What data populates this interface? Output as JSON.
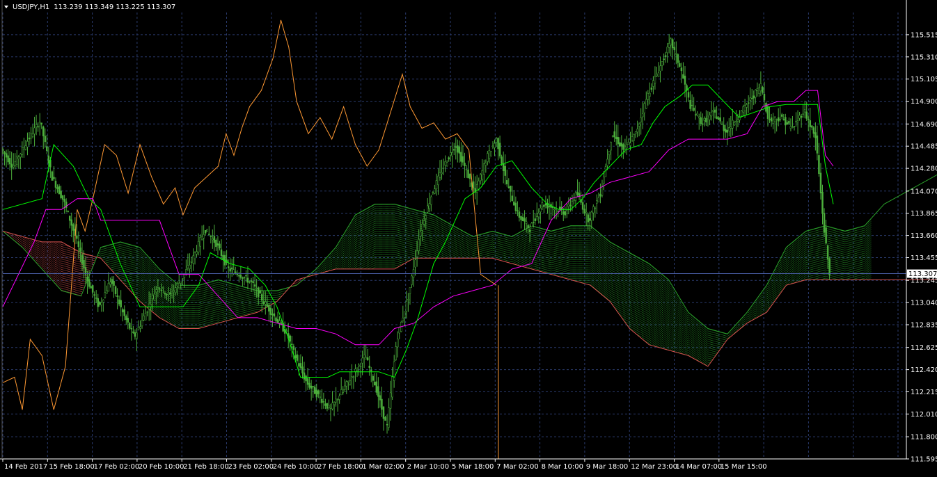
{
  "header": {
    "symbol": "USDJPY,H1",
    "quote": "113.239 113.349 113.225 113.307"
  },
  "chart_data": {
    "type": "line",
    "subtype": "candlestick-ichimoku",
    "symbol": "USDJPY",
    "timeframe": "H1",
    "ohlc_last": {
      "open": 113.239,
      "high": 113.349,
      "low": 113.225,
      "close": 113.307
    },
    "current_price_label": "113.307",
    "current_price": 113.307,
    "grid": true,
    "legend": "none",
    "ylim": [
      111.595,
      115.72
    ],
    "y_ticks": [
      "115.515",
      "115.310",
      "115.105",
      "114.900",
      "114.690",
      "114.485",
      "114.280",
      "114.070",
      "113.865",
      "113.660",
      "113.455",
      "113.245",
      "113.040",
      "112.835",
      "112.625",
      "112.420",
      "112.215",
      "112.010",
      "111.800",
      "111.595"
    ],
    "x_ticks": [
      "14 Feb 2017",
      "15 Feb 18:00",
      "17 Feb 02:00",
      "20 Feb 10:00",
      "21 Feb 18:00",
      "23 Feb 02:00",
      "24 Feb 10:00",
      "27 Feb 18:00",
      "1 Mar 02:00",
      "2 Mar 10:00",
      "5 Mar 18:00",
      "7 Mar 02:00",
      "8 Mar 10:00",
      "9 Mar 18:00",
      "12 Mar 23:00",
      "14 Mar 07:00",
      "15 Mar 15:00"
    ],
    "x_extent": [
      0,
      22
    ],
    "colors": {
      "background": "#000000",
      "grid": "#2b3b6e",
      "axis": "#ffffff",
      "text": "#ffffff",
      "candles": "#4cae3c",
      "tenkan": "#00ff00",
      "kijun": "#ff00ff",
      "chikou": "#ff9933",
      "kumo_bull": "#2aa12a",
      "kumo_bear": "#d9534f",
      "price_line": "#4a5fa8"
    },
    "series_points": {
      "price_path": [
        [
          0,
          114.46
        ],
        [
          0.3,
          114.3
        ],
        [
          0.7,
          114.55
        ],
        [
          1.0,
          114.72
        ],
        [
          1.3,
          114.2
        ],
        [
          1.6,
          113.98
        ],
        [
          1.9,
          113.65
        ],
        [
          2.2,
          113.25
        ],
        [
          2.5,
          113.0
        ],
        [
          2.8,
          113.25
        ],
        [
          3.1,
          112.95
        ],
        [
          3.4,
          112.72
        ],
        [
          3.7,
          112.95
        ],
        [
          4.0,
          113.2
        ],
        [
          4.3,
          113.1
        ],
        [
          4.6,
          113.25
        ],
        [
          4.9,
          113.45
        ],
        [
          5.2,
          113.72
        ],
        [
          5.5,
          113.58
        ],
        [
          5.8,
          113.35
        ],
        [
          6.1,
          113.3
        ],
        [
          6.4,
          113.22
        ],
        [
          6.7,
          113.05
        ],
        [
          7.0,
          112.9
        ],
        [
          7.3,
          112.75
        ],
        [
          7.5,
          112.55
        ],
        [
          7.8,
          112.3
        ],
        [
          8.1,
          112.18
        ],
        [
          8.4,
          112.05
        ],
        [
          8.7,
          112.22
        ],
        [
          9.0,
          112.38
        ],
        [
          9.3,
          112.55
        ],
        [
          9.6,
          112.22
        ],
        [
          9.85,
          111.88
        ],
        [
          10.1,
          112.7
        ],
        [
          10.4,
          113.1
        ],
        [
          10.7,
          113.7
        ],
        [
          11.0,
          114.05
        ],
        [
          11.3,
          114.3
        ],
        [
          11.6,
          114.5
        ],
        [
          11.85,
          114.28
        ],
        [
          12.1,
          114.05
        ],
        [
          12.4,
          114.38
        ],
        [
          12.65,
          114.55
        ],
        [
          12.9,
          114.15
        ],
        [
          13.2,
          113.85
        ],
        [
          13.5,
          113.72
        ],
        [
          13.8,
          113.95
        ],
        [
          14.1,
          113.92
        ],
        [
          14.4,
          113.87
        ],
        [
          14.7,
          114.05
        ],
        [
          15.0,
          113.8
        ],
        [
          15.3,
          114.05
        ],
        [
          15.6,
          114.6
        ],
        [
          15.9,
          114.45
        ],
        [
          16.2,
          114.6
        ],
        [
          16.5,
          114.95
        ],
        [
          16.8,
          115.2
        ],
        [
          17.1,
          115.45
        ],
        [
          17.35,
          115.2
        ],
        [
          17.6,
          114.85
        ],
        [
          17.9,
          114.7
        ],
        [
          18.2,
          114.8
        ],
        [
          18.5,
          114.62
        ],
        [
          18.8,
          114.75
        ],
        [
          19.1,
          114.9
        ],
        [
          19.4,
          115.05
        ],
        [
          19.6,
          114.72
        ],
        [
          19.9,
          114.75
        ],
        [
          20.2,
          114.65
        ],
        [
          20.5,
          114.82
        ],
        [
          20.8,
          114.55
        ],
        [
          21.0,
          113.75
        ],
        [
          21.15,
          113.3
        ]
      ],
      "tenkan": [
        [
          0,
          113.9
        ],
        [
          1.0,
          114.0
        ],
        [
          1.3,
          114.5
        ],
        [
          1.8,
          114.3
        ],
        [
          2.2,
          114.0
        ],
        [
          2.5,
          113.9
        ],
        [
          3.0,
          113.4
        ],
        [
          3.5,
          113.0
        ],
        [
          4.0,
          113.0
        ],
        [
          4.6,
          113.0
        ],
        [
          5.0,
          113.2
        ],
        [
          5.3,
          113.5
        ],
        [
          5.8,
          113.4
        ],
        [
          6.3,
          113.35
        ],
        [
          6.7,
          113.2
        ],
        [
          7.0,
          113.0
        ],
        [
          7.3,
          112.7
        ],
        [
          7.6,
          112.35
        ],
        [
          7.9,
          112.35
        ],
        [
          8.3,
          112.35
        ],
        [
          8.6,
          112.4
        ],
        [
          9.0,
          112.4
        ],
        [
          9.3,
          112.4
        ],
        [
          9.6,
          112.4
        ],
        [
          10.0,
          112.35
        ],
        [
          10.3,
          112.6
        ],
        [
          10.6,
          112.9
        ],
        [
          11.0,
          113.4
        ],
        [
          11.3,
          113.6
        ],
        [
          11.8,
          114.0
        ],
        [
          12.2,
          114.1
        ],
        [
          12.6,
          114.3
        ],
        [
          13.0,
          114.35
        ],
        [
          13.5,
          114.1
        ],
        [
          13.9,
          113.95
        ],
        [
          14.2,
          113.9
        ],
        [
          14.5,
          113.9
        ],
        [
          14.8,
          114.0
        ],
        [
          15.1,
          114.15
        ],
        [
          15.5,
          114.3
        ],
        [
          15.9,
          114.45
        ],
        [
          16.3,
          114.5
        ],
        [
          16.6,
          114.7
        ],
        [
          16.9,
          114.85
        ],
        [
          17.3,
          114.95
        ],
        [
          17.6,
          115.05
        ],
        [
          18.0,
          115.05
        ],
        [
          18.4,
          114.9
        ],
        [
          18.8,
          114.75
        ],
        [
          19.2,
          114.8
        ],
        [
          19.6,
          114.85
        ],
        [
          20.0,
          114.87
        ],
        [
          20.5,
          114.87
        ],
        [
          20.8,
          114.87
        ],
        [
          21.0,
          114.3
        ],
        [
          21.2,
          113.95
        ]
      ],
      "kijun": [
        [
          0,
          113.0
        ],
        [
          0.4,
          113.3
        ],
        [
          0.8,
          113.6
        ],
        [
          1.1,
          113.9
        ],
        [
          1.5,
          113.9
        ],
        [
          1.9,
          114.0
        ],
        [
          2.3,
          114.0
        ],
        [
          2.5,
          113.8
        ],
        [
          3.0,
          113.8
        ],
        [
          3.5,
          113.8
        ],
        [
          4.0,
          113.8
        ],
        [
          4.5,
          113.3
        ],
        [
          5.0,
          113.3
        ],
        [
          5.5,
          113.1
        ],
        [
          6.0,
          112.9
        ],
        [
          6.5,
          112.9
        ],
        [
          7.0,
          112.85
        ],
        [
          7.5,
          112.8
        ],
        [
          8.0,
          112.8
        ],
        [
          8.5,
          112.75
        ],
        [
          9.0,
          112.65
        ],
        [
          9.6,
          112.65
        ],
        [
          10.0,
          112.8
        ],
        [
          10.5,
          112.85
        ],
        [
          11.0,
          113.0
        ],
        [
          11.5,
          113.1
        ],
        [
          12.0,
          113.15
        ],
        [
          12.5,
          113.2
        ],
        [
          13.0,
          113.35
        ],
        [
          13.5,
          113.4
        ],
        [
          14.0,
          113.8
        ],
        [
          14.5,
          114.0
        ],
        [
          15.0,
          114.05
        ],
        [
          15.5,
          114.15
        ],
        [
          16.0,
          114.2
        ],
        [
          16.5,
          114.25
        ],
        [
          17.0,
          114.45
        ],
        [
          17.5,
          114.55
        ],
        [
          18.0,
          114.55
        ],
        [
          18.5,
          114.55
        ],
        [
          19.0,
          114.6
        ],
        [
          19.4,
          114.85
        ],
        [
          19.8,
          114.9
        ],
        [
          20.2,
          114.9
        ],
        [
          20.5,
          115.0
        ],
        [
          20.8,
          115.0
        ],
        [
          21.0,
          114.4
        ],
        [
          21.2,
          114.3
        ]
      ],
      "chikou": [
        [
          0,
          112.3
        ],
        [
          0.3,
          112.35
        ],
        [
          0.5,
          112.05
        ],
        [
          0.7,
          112.7
        ],
        [
          1.0,
          112.55
        ],
        [
          1.3,
          112.05
        ],
        [
          1.6,
          112.45
        ],
        [
          1.9,
          113.9
        ],
        [
          2.1,
          113.7
        ],
        [
          2.3,
          114.0
        ],
        [
          2.6,
          114.5
        ],
        [
          2.9,
          114.4
        ],
        [
          3.2,
          114.05
        ],
        [
          3.5,
          114.5
        ],
        [
          3.8,
          114.2
        ],
        [
          4.1,
          113.95
        ],
        [
          4.4,
          114.1
        ],
        [
          4.6,
          113.85
        ],
        [
          4.9,
          114.1
        ],
        [
          5.2,
          114.2
        ],
        [
          5.5,
          114.3
        ],
        [
          5.7,
          114.6
        ],
        [
          5.9,
          114.4
        ],
        [
          6.1,
          114.65
        ],
        [
          6.3,
          114.85
        ],
        [
          6.6,
          115.0
        ],
        [
          6.9,
          115.3
        ],
        [
          7.1,
          115.65
        ],
        [
          7.3,
          115.4
        ],
        [
          7.5,
          114.9
        ],
        [
          7.8,
          114.6
        ],
        [
          8.1,
          114.75
        ],
        [
          8.4,
          114.55
        ],
        [
          8.7,
          114.85
        ],
        [
          9.0,
          114.5
        ],
        [
          9.3,
          114.3
        ],
        [
          9.6,
          114.45
        ],
        [
          9.9,
          114.8
        ],
        [
          10.2,
          115.15
        ],
        [
          10.4,
          114.85
        ],
        [
          10.7,
          114.65
        ],
        [
          11.0,
          114.7
        ],
        [
          11.3,
          114.55
        ],
        [
          11.6,
          114.6
        ],
        [
          11.9,
          114.45
        ],
        [
          12.2,
          113.3
        ],
        [
          12.4,
          113.25
        ],
        [
          12.6,
          113.2
        ]
      ],
      "chikou_tail": [
        [
          12.65,
          113.2
        ],
        [
          12.65,
          111.595
        ]
      ],
      "span_a": [
        [
          0,
          113.7
        ],
        [
          0.5,
          113.55
        ],
        [
          1.0,
          113.35
        ],
        [
          1.5,
          113.15
        ],
        [
          2.0,
          113.1
        ],
        [
          2.5,
          113.55
        ],
        [
          3.0,
          113.6
        ],
        [
          3.5,
          113.55
        ],
        [
          4.0,
          113.35
        ],
        [
          4.5,
          113.2
        ],
        [
          5.0,
          113.2
        ],
        [
          5.5,
          113.25
        ],
        [
          6.0,
          113.2
        ],
        [
          6.5,
          113.15
        ],
        [
          7.0,
          113.15
        ],
        [
          7.5,
          113.2
        ],
        [
          8.0,
          113.35
        ],
        [
          8.5,
          113.55
        ],
        [
          9.0,
          113.85
        ],
        [
          9.5,
          113.95
        ],
        [
          10.0,
          113.95
        ],
        [
          10.5,
          113.9
        ],
        [
          11.0,
          113.85
        ],
        [
          11.5,
          113.75
        ],
        [
          12.0,
          113.65
        ],
        [
          12.5,
          113.7
        ],
        [
          13.0,
          113.65
        ],
        [
          13.5,
          113.75
        ],
        [
          14.0,
          113.7
        ],
        [
          14.5,
          113.75
        ],
        [
          15.0,
          113.75
        ],
        [
          15.5,
          113.6
        ],
        [
          16.0,
          113.5
        ],
        [
          16.5,
          113.4
        ],
        [
          17.0,
          113.25
        ],
        [
          17.5,
          112.95
        ],
        [
          18.0,
          112.8
        ],
        [
          18.5,
          112.75
        ],
        [
          19.0,
          112.95
        ],
        [
          19.5,
          113.2
        ],
        [
          20.0,
          113.55
        ],
        [
          20.5,
          113.7
        ],
        [
          21.0,
          113.75
        ],
        [
          21.5,
          113.7
        ],
        [
          22.0,
          113.75
        ],
        [
          22.5,
          113.95
        ],
        [
          23.0,
          114.05
        ],
        [
          23.5,
          114.15
        ],
        [
          24.0,
          114.25
        ],
        [
          24.5,
          114.4
        ],
        [
          25.0,
          114.6
        ]
      ],
      "span_b": [
        [
          0,
          113.7
        ],
        [
          0.5,
          113.65
        ],
        [
          1.0,
          113.6
        ],
        [
          1.5,
          113.6
        ],
        [
          2.0,
          113.5
        ],
        [
          2.5,
          113.45
        ],
        [
          3.0,
          113.25
        ],
        [
          3.5,
          113.05
        ],
        [
          4.0,
          112.9
        ],
        [
          4.5,
          112.8
        ],
        [
          5.0,
          112.8
        ],
        [
          5.5,
          112.85
        ],
        [
          6.0,
          112.9
        ],
        [
          6.5,
          112.95
        ],
        [
          7.0,
          113.05
        ],
        [
          7.5,
          113.25
        ],
        [
          8.0,
          113.3
        ],
        [
          8.5,
          113.35
        ],
        [
          9.0,
          113.35
        ],
        [
          9.5,
          113.35
        ],
        [
          10.0,
          113.35
        ],
        [
          10.5,
          113.45
        ],
        [
          11.0,
          113.45
        ],
        [
          11.5,
          113.45
        ],
        [
          12.0,
          113.45
        ],
        [
          12.5,
          113.45
        ],
        [
          13.0,
          113.4
        ],
        [
          13.5,
          113.35
        ],
        [
          14.0,
          113.3
        ],
        [
          14.5,
          113.25
        ],
        [
          15.0,
          113.2
        ],
        [
          15.5,
          113.05
        ],
        [
          16.0,
          112.8
        ],
        [
          16.5,
          112.65
        ],
        [
          17.0,
          112.6
        ],
        [
          17.5,
          112.55
        ],
        [
          18.0,
          112.45
        ],
        [
          18.5,
          112.7
        ],
        [
          19.0,
          112.85
        ],
        [
          19.5,
          112.95
        ],
        [
          20.0,
          113.2
        ],
        [
          20.5,
          113.25
        ],
        [
          21.0,
          113.25
        ],
        [
          21.5,
          113.25
        ],
        [
          22.0,
          113.25
        ],
        [
          22.5,
          113.25
        ],
        [
          23.0,
          113.25
        ],
        [
          23.5,
          113.25
        ],
        [
          24.0,
          113.25
        ],
        [
          24.5,
          113.3
        ],
        [
          25.0,
          113.5
        ]
      ]
    }
  }
}
